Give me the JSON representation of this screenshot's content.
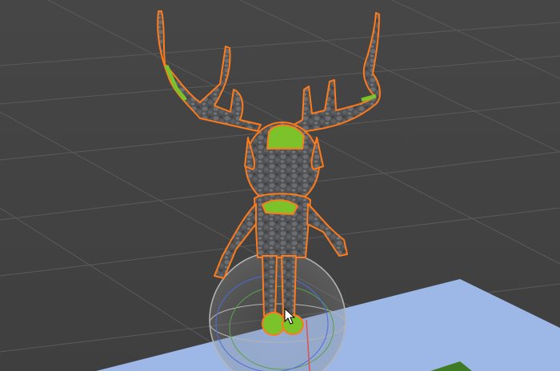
{
  "viewport": {
    "background_color": "#444444",
    "grid_color": "#5a5a5a",
    "ground_plane_color": "#9db8e6",
    "selection_outline_color": "#ff7a1a",
    "gizmo_x_color": "#e05050",
    "gizmo_y_color": "#5aa050",
    "gizmo_z_color": "#4a6ee0"
  },
  "character": {
    "stone_color": "#4f5153",
    "moss_color": "#7cc22a"
  },
  "cursor": {
    "icon": "mouse-pointer-icon"
  }
}
